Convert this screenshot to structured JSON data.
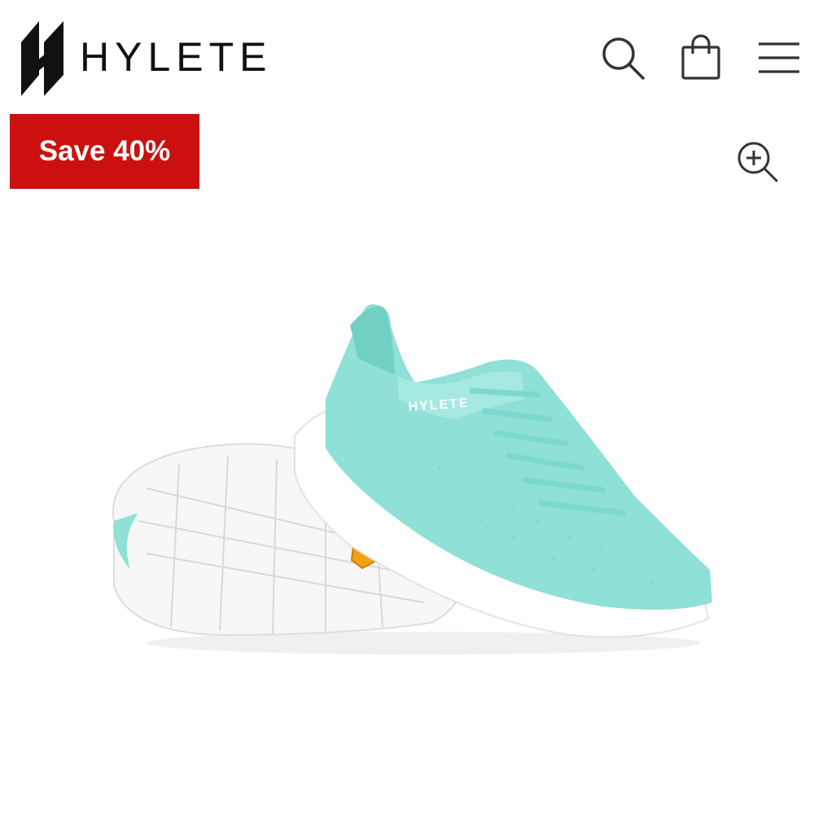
{
  "header": {
    "brand": "HYLETE",
    "icons": {
      "search": "search-icon",
      "bag": "shopping-bag-icon",
      "menu": "hamburger-menu-icon"
    }
  },
  "product": {
    "badge": "Save 40%",
    "badge_color": "#cc1010",
    "zoom_icon": "zoom-in-icon",
    "shoe_color": "#8fe0d6",
    "sole_color": "#ffffff",
    "upper_brand": "HYLETE"
  }
}
